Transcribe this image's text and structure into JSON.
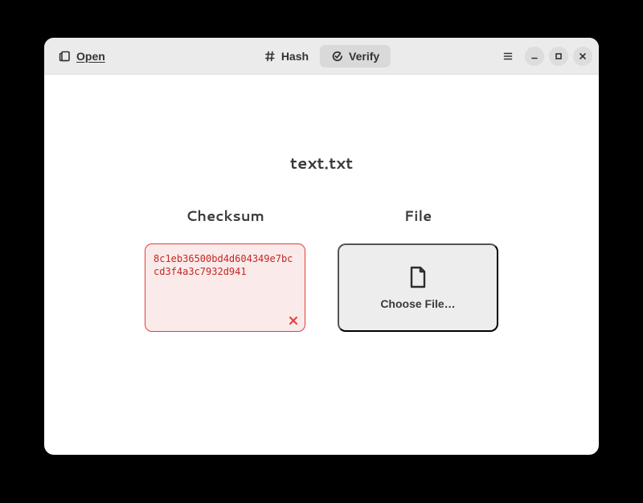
{
  "header": {
    "open_label": "Open",
    "tabs": {
      "hash_label": "Hash",
      "verify_label": "Verify"
    }
  },
  "main": {
    "filename": "text.txt",
    "checksum": {
      "title": "Checksum",
      "value": "8c1eb36500bd4d604349e7b­ccd3f4a3c7932d941"
    },
    "file": {
      "title": "File",
      "choose_label": "Choose File…"
    }
  },
  "colors": {
    "error_border": "#e33e3a",
    "error_bg": "#fbeaea",
    "error_fg": "#c22824"
  }
}
